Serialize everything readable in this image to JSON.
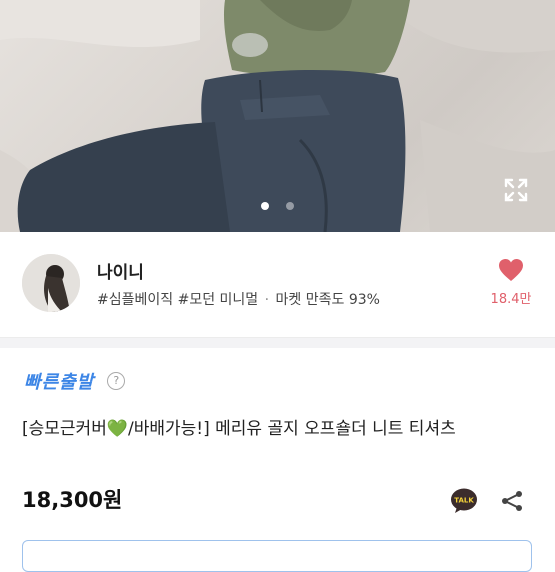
{
  "gallery": {
    "dots": [
      {
        "active": true
      },
      {
        "active": false
      }
    ],
    "expand_icon": "expand-icon"
  },
  "seller": {
    "name": "나이니",
    "tag1": "#심플베이직",
    "tag2": "#모던 미니멀",
    "separator": "·",
    "rating_text": "마켓 만족도 93%",
    "likes": "18.4만",
    "like_icon": "heart-icon",
    "like_color": "#e0606b"
  },
  "product": {
    "fast_label": "빠른출발",
    "help_icon_label": "?",
    "title_pre": "[승모근커버",
    "title_post": "/바배가능!] 메리유 골지 오프숄더 니트 티셔츠",
    "title_heart": "💚",
    "price": "18,300원",
    "talk_icon_label": "TALK",
    "accent_color": "#3d86e6"
  }
}
